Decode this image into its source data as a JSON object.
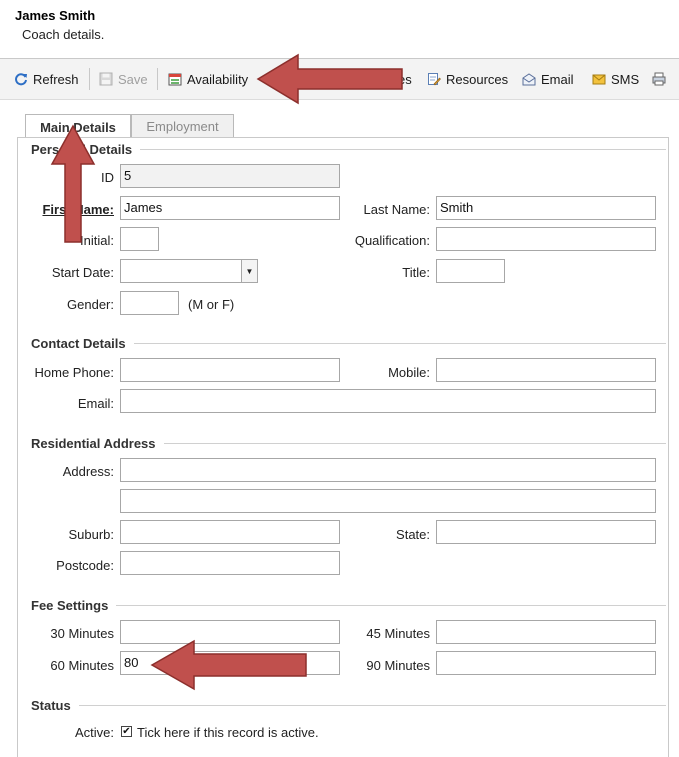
{
  "header": {
    "title": "James Smith",
    "subtitle": "Coach details."
  },
  "toolbar": {
    "refresh": "Refresh",
    "save": "Save",
    "availability": "Availability",
    "hidden_partial": "es",
    "resources": "Resources",
    "email": "Email",
    "sms": "SMS"
  },
  "tabs": [
    {
      "label": "Main Details",
      "active": true
    },
    {
      "label": "Employment",
      "active": false
    }
  ],
  "personal": {
    "section": "Personal Details",
    "id_label": "ID",
    "id_value": "5",
    "first_name_label": "First Name:",
    "first_name_value": "James",
    "last_name_label": "Last Name:",
    "last_name_value": "Smith",
    "initial_label": "Initial:",
    "initial_value": "",
    "qualification_label": "Qualification:",
    "qualification_value": "",
    "start_date_label": "Start Date:",
    "start_date_value": "",
    "title_label": "Title:",
    "title_value": "",
    "gender_label": "Gender:",
    "gender_value": "",
    "gender_hint": "(M or F)"
  },
  "contact": {
    "section": "Contact Details",
    "home_phone_label": "Home Phone:",
    "home_phone_value": "",
    "mobile_label": "Mobile:",
    "mobile_value": "",
    "email_label": "Email:",
    "email_value": ""
  },
  "address": {
    "section": "Residential Address",
    "address_label": "Address:",
    "address_line1": "",
    "address_line2": "",
    "suburb_label": "Suburb:",
    "suburb_value": "",
    "state_label": "State:",
    "state_value": "",
    "postcode_label": "Postcode:",
    "postcode_value": ""
  },
  "fees": {
    "section": "Fee Settings",
    "m30_label": "30 Minutes",
    "m30_value": "",
    "m45_label": "45 Minutes",
    "m45_value": "",
    "m60_label": "60 Minutes",
    "m60_value": "80",
    "m90_label": "90 Minutes",
    "m90_value": ""
  },
  "status": {
    "section": "Status",
    "active_label": "Active:",
    "active_checked": true,
    "active_text": "Tick here if this record is active."
  },
  "colors": {
    "arrow_fill": "#c0504d",
    "arrow_edge": "#8c2f2c"
  }
}
